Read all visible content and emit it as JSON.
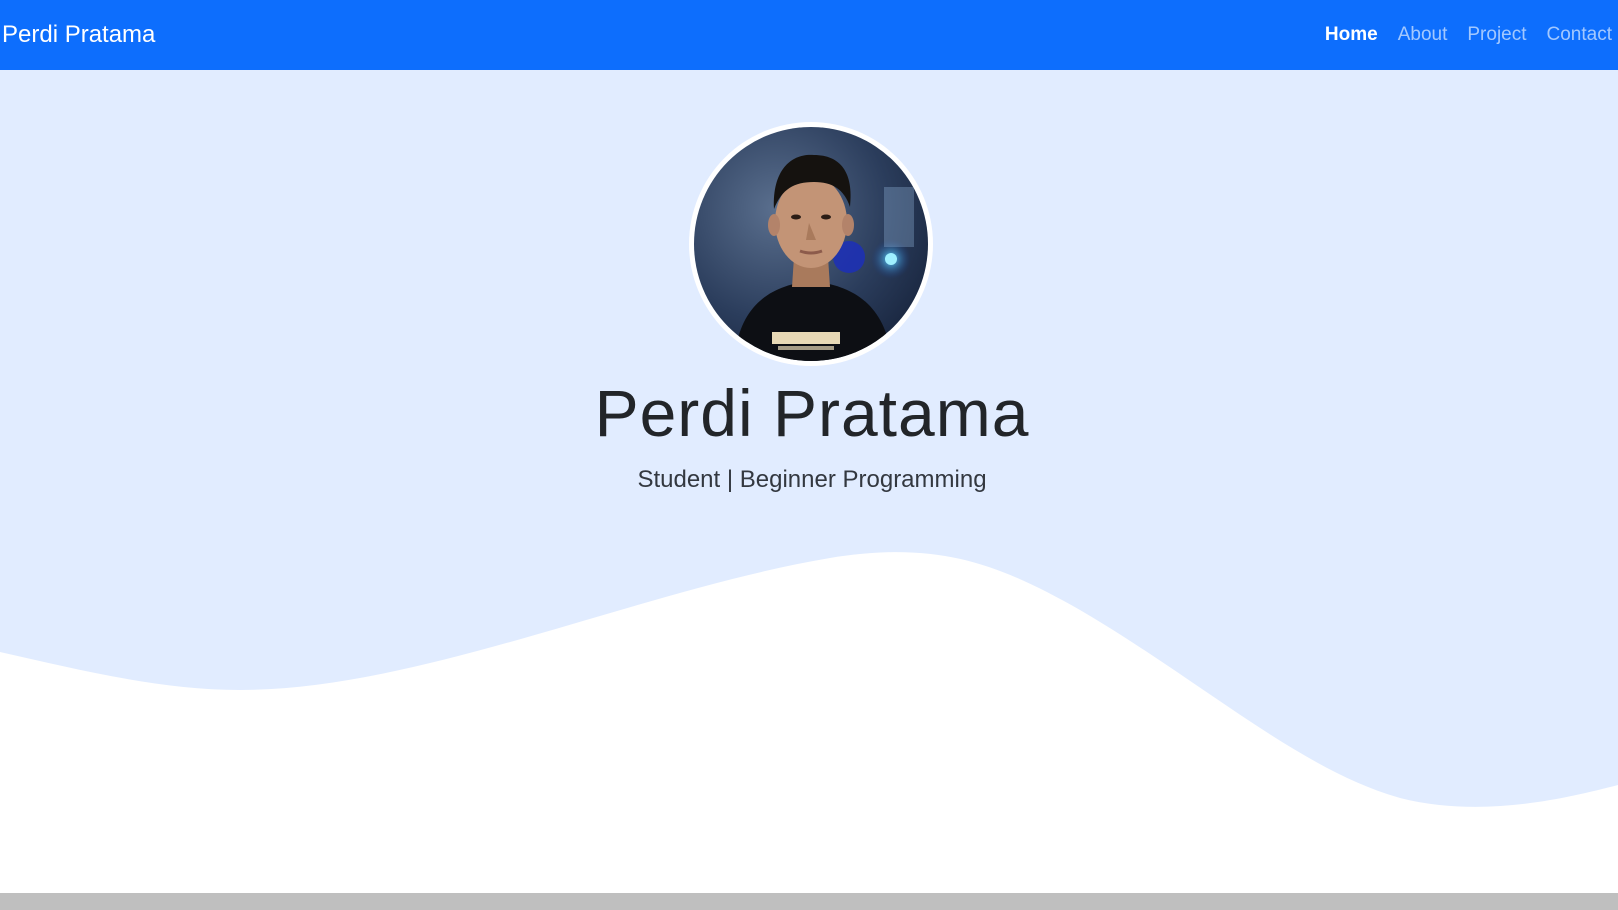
{
  "navbar": {
    "brand": "Perdi Pratama",
    "links": [
      {
        "label": "Home",
        "active": true
      },
      {
        "label": "About",
        "active": false
      },
      {
        "label": "Project",
        "active": false
      },
      {
        "label": "Contact",
        "active": false
      }
    ]
  },
  "hero": {
    "title": "Perdi Pratama",
    "subtitle": "Student | Beginner Programming",
    "avatar": "profile-photo"
  },
  "colors": {
    "navbar_bg": "#0d6efd",
    "hero_bg": "#e1ecff",
    "wave_fill": "#ffffff"
  }
}
